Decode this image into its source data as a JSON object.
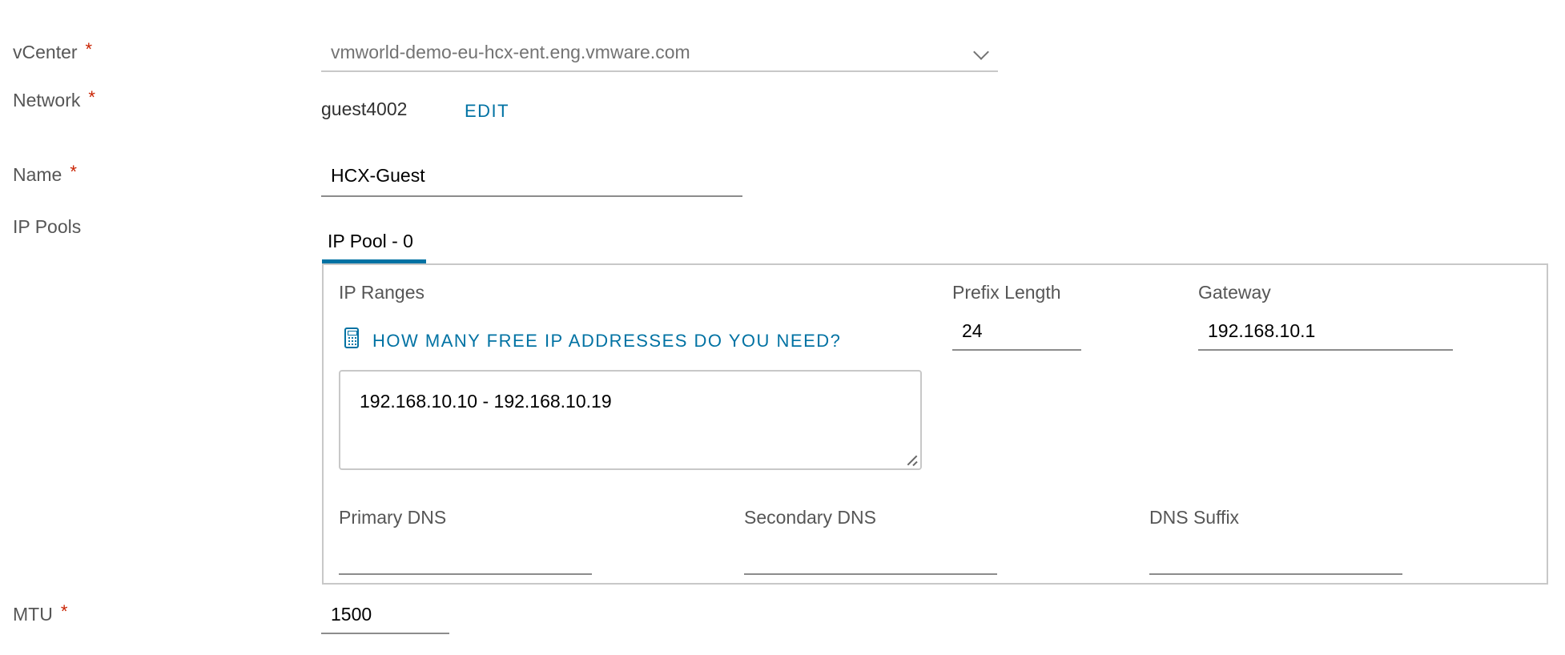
{
  "form": {
    "vcenter": {
      "label": "vCenter",
      "required_mark": "*",
      "value": "vmworld-demo-eu-hcx-ent.eng.vmware.com",
      "icon": "chevron-down-icon"
    },
    "network": {
      "label": "Network",
      "required_mark": "*",
      "value": "guest4002",
      "edit_label": "EDIT"
    },
    "name": {
      "label": "Name",
      "required_mark": "*",
      "value": "HCX-Guest"
    },
    "ip_pools": {
      "label": "IP Pools",
      "tabs": [
        {
          "label": "IP Pool - 0",
          "active": true
        }
      ],
      "pool": {
        "ip_ranges": {
          "label": "IP Ranges",
          "helper_link": "HOW MANY FREE IP ADDRESSES DO YOU NEED?",
          "helper_icon": "calculator-icon",
          "value": "192.168.10.10 - 192.168.10.19"
        },
        "prefix_length": {
          "label": "Prefix Length",
          "value": "24"
        },
        "gateway": {
          "label": "Gateway",
          "value": "192.168.10.1"
        },
        "primary_dns": {
          "label": "Primary DNS",
          "value": ""
        },
        "secondary_dns": {
          "label": "Secondary DNS",
          "value": ""
        },
        "dns_suffix": {
          "label": "DNS Suffix",
          "value": ""
        }
      }
    },
    "mtu": {
      "label": "MTU",
      "required_mark": "*",
      "value": "1500"
    }
  },
  "colors": {
    "accent": "#0072a3",
    "required": "#c92100",
    "label_text": "#565656",
    "input_underline": "#8c8c8c",
    "border": "#c8c8c8"
  }
}
